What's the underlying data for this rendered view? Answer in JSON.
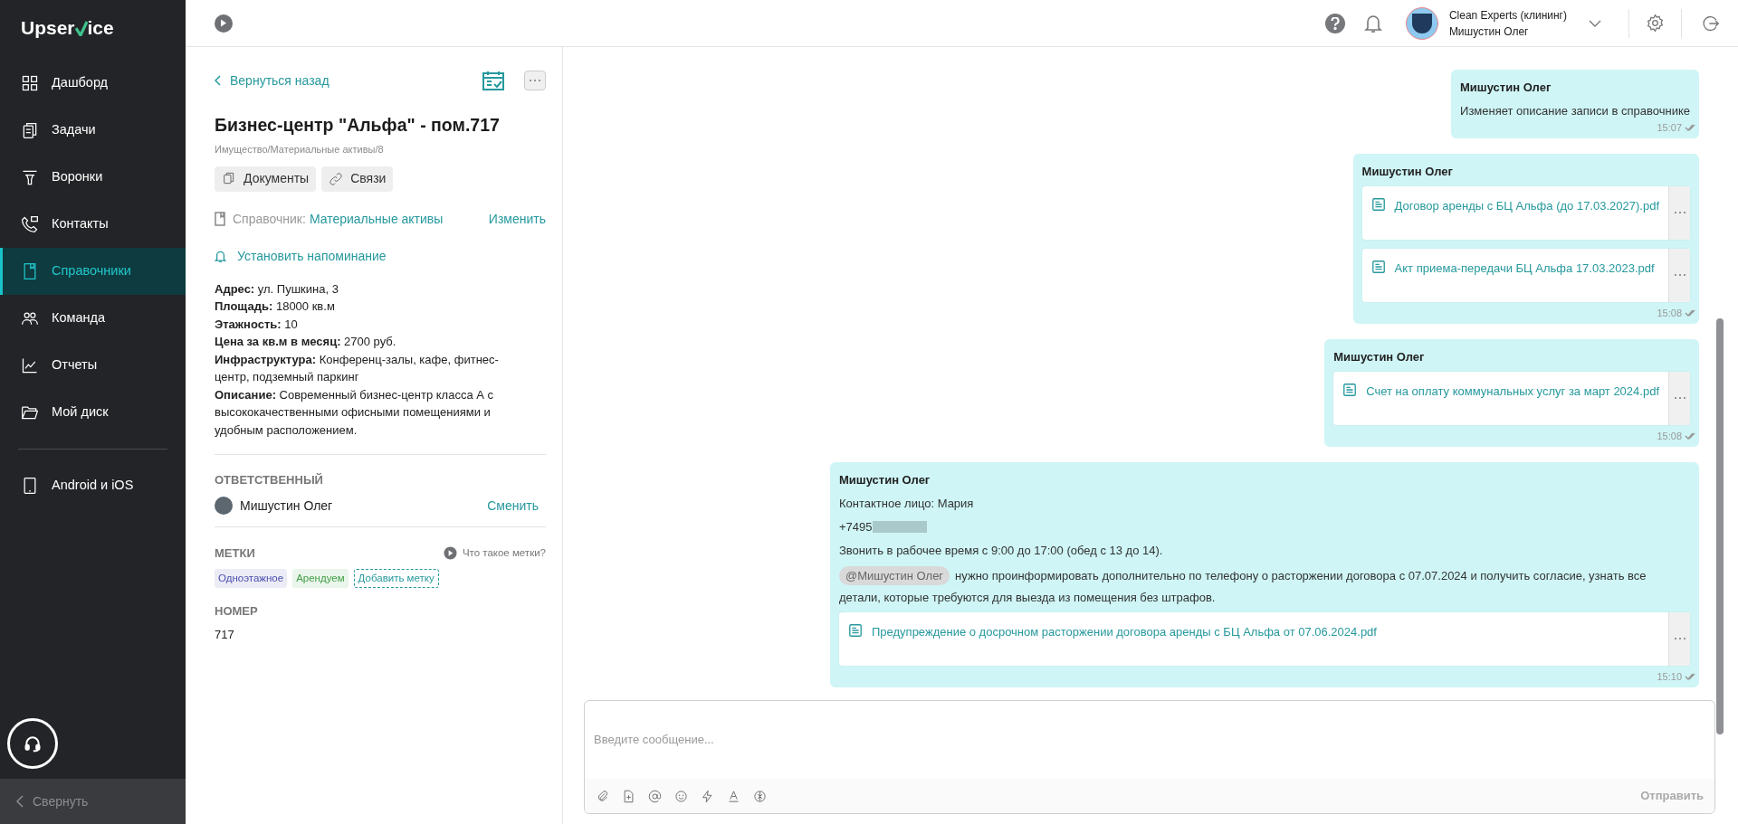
{
  "sidebar": {
    "logo": {
      "before": "Upser",
      "after": "ice"
    },
    "items": [
      {
        "label": "Дашборд",
        "selected": false
      },
      {
        "label": "Задачи",
        "selected": false
      },
      {
        "label": "Воронки",
        "selected": false
      },
      {
        "label": "Контакты",
        "selected": false
      },
      {
        "label": "Справочники",
        "selected": true
      },
      {
        "label": "Команда",
        "selected": false
      },
      {
        "label": "Отчеты",
        "selected": false
      },
      {
        "label": "Мой диск",
        "selected": false
      }
    ],
    "apps_item": {
      "label": "Android и iOS",
      "selected": false
    },
    "collapse": "Свернуть"
  },
  "topbar": {
    "account": {
      "company": "Clean Experts (клининг)",
      "user": "Мишустин Олег"
    }
  },
  "record": {
    "back": "Вернуться назад",
    "title": "Бизнес-центр \"Альфа\" - пом.717",
    "path": "Имущество/Материальные активы/8",
    "buttons": [
      "Документы",
      "Связи"
    ],
    "directory": {
      "label": "Справочник:",
      "value": "Материальные активы",
      "action": "Изменить"
    },
    "reminder": "Установить напоминание",
    "fields": [
      "**Адрес:** ул. Пушкина, 3",
      "**Площадь:** 18000 кв.м",
      "**Этажность:** 10",
      "**Цена за кв.м в месяц:** 2700 руб.",
      "**Инфраструктура:** Конференц-залы, кафе, фитнес-центр, подземный паркинг",
      "**Описание:** Современный бизнес-центр класса А с высококачественными офисными помещениями и удобным расположением."
    ],
    "responsible": {
      "heading": "ОТВЕТСТВЕННЫЙ",
      "name": "Мишустин Олег",
      "action": "Сменить"
    },
    "tags": {
      "heading": "МЕТКИ",
      "help": "Что такое метки?",
      "items": [
        {
          "label": "Одноэтажное",
          "color": "#4c4fb0"
        },
        {
          "label": "Арендуем",
          "color": "#43a047"
        }
      ],
      "add": "Добавить метку"
    },
    "number": {
      "heading": "НОМЕР",
      "value": "717"
    }
  },
  "chat": {
    "messages": [
      {
        "author": "Мишустин Олег",
        "parts": [
          {
            "kind": "text",
            "text": "Изменяет описание записи в справочнике"
          }
        ],
        "time": "15:07",
        "read": true
      },
      {
        "author": "Мишустин Олег",
        "parts": [
          {
            "kind": "file",
            "text": "Договор аренды с БЦ Альфа (до 17.03.2027).pdf"
          },
          {
            "kind": "file",
            "text": "Акт приема-передачи БЦ Альфа 17.03.2023.pdf"
          }
        ],
        "time": "15:08",
        "read": true
      },
      {
        "author": "Мишустин Олег",
        "parts": [
          {
            "kind": "file",
            "text": "Счет на оплату коммунальных услуг за март 2024.pdf"
          }
        ],
        "time": "15:08",
        "read": true
      },
      {
        "author": "Мишустин Олег",
        "parts": [
          {
            "kind": "text",
            "text": "Контактное лицо: Мария"
          },
          {
            "kind": "phone",
            "text": "+7495"
          },
          {
            "kind": "text",
            "text": "Звонить в рабочее время с 9:00 до 17:00 (обед с 13 до 14)."
          },
          {
            "kind": "mention",
            "mention": "@Мишустин Олег",
            "text": "нужно проинформировать дополнительно по телефону о расторжении договора с 07.07.2024 и получить согласие, узнать все детали, которые требуются для выезда из помещения без штрафов."
          },
          {
            "kind": "file",
            "text": "Предупреждение о досрочном расторжении договора аренды с БЦ Альфа от 07.06.2024.pdf"
          }
        ],
        "time": "15:10",
        "read": true
      }
    ],
    "composer": {
      "placeholder": "Введите сообщение...",
      "send": "Отправить"
    }
  }
}
